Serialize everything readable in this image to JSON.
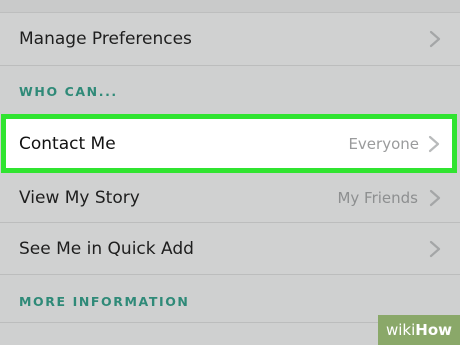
{
  "rows": {
    "manage_preferences": {
      "label": "Manage Preferences"
    },
    "contact_me": {
      "label": "Contact Me",
      "value": "Everyone"
    },
    "view_my_story": {
      "label": "View My Story",
      "value": "My Friends"
    },
    "quick_add": {
      "label": "See Me in Quick Add"
    }
  },
  "sections": {
    "who_can": "WHO CAN...",
    "more_information": "MORE INFORMATION"
  },
  "watermark": {
    "wiki": "wiki",
    "how": "How"
  },
  "colors": {
    "background": "#d0d1d1",
    "section_header": "#2f8a78",
    "highlight_border": "#30e430",
    "watermark_bg": "#8aa869"
  },
  "icons": {
    "chevron": "chevron-right-icon"
  }
}
